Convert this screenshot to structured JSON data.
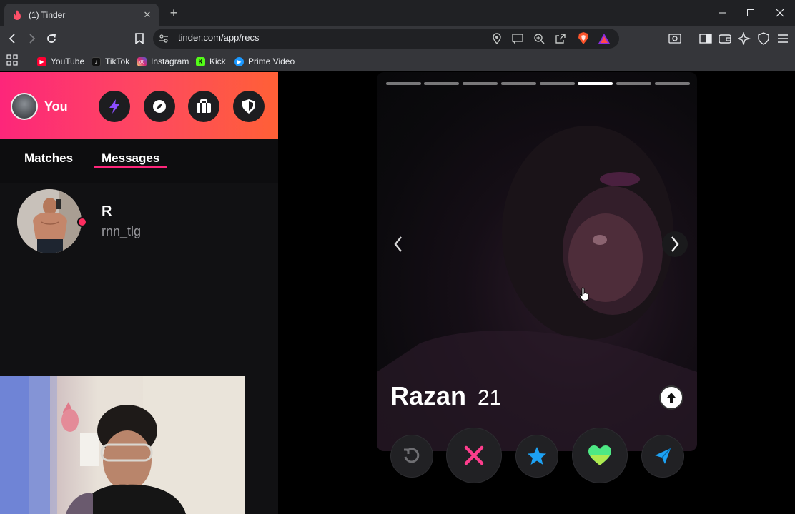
{
  "browser": {
    "tab_title": "(1) Tinder",
    "url": "tinder.com/app/recs",
    "bookmarks": [
      {
        "label": "YouTube",
        "icon": "youtube-icon",
        "color": "#ff0033"
      },
      {
        "label": "TikTok",
        "icon": "tiktok-icon",
        "color": "#111111"
      },
      {
        "label": "Instagram",
        "icon": "instagram-icon",
        "color": "#d6249f"
      },
      {
        "label": "Kick",
        "icon": "kick-icon",
        "color": "#53fc18"
      },
      {
        "label": "Prime Video",
        "icon": "prime-video-icon",
        "color": "#1a98ff"
      }
    ]
  },
  "sidebar": {
    "user_label": "You",
    "tabs": {
      "matches": "Matches",
      "messages": "Messages"
    },
    "active_tab": "Messages",
    "messages": [
      {
        "name": "R",
        "preview": "rnn_tlg",
        "online": true
      }
    ]
  },
  "card": {
    "name": "Razan",
    "age": "21",
    "photo_count": 8,
    "active_photo": 6
  },
  "colors": {
    "brand_gradient_start": "#fd267a",
    "brand_gradient_end": "#ff6036",
    "nope": "#fd3d8c",
    "super_like": "#1da1f2",
    "like": "#4ee884",
    "boost": "#7a3cff"
  }
}
